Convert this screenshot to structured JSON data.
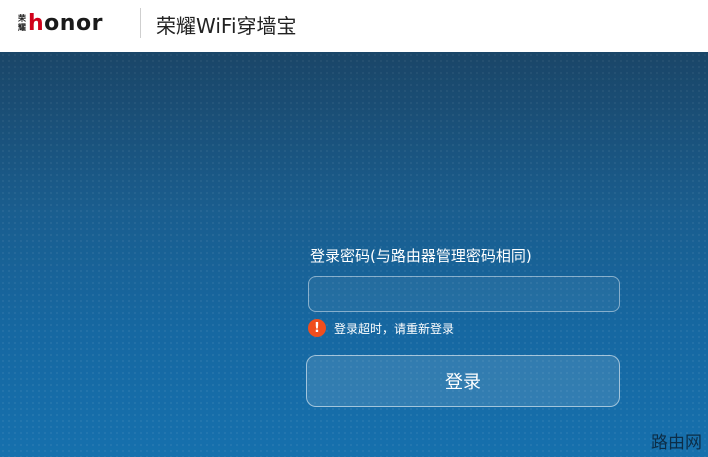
{
  "header": {
    "logo_cn": [
      "荣",
      "耀"
    ],
    "logo_word_first": "h",
    "logo_word_rest": "onor",
    "app_title": "荣耀WiFi穿墙宝"
  },
  "login": {
    "password_label": "登录密码(与路由器管理密码相同)",
    "password_value": "",
    "error_icon": "!",
    "error_message": "登录超时，请重新登录",
    "login_button": "登录"
  },
  "watermark": "路由网",
  "colors": {
    "accent_red": "#d0021b",
    "error_orange": "#f04e1e",
    "bg_top": "#1d4f76",
    "bg_bottom": "#1670ad"
  }
}
